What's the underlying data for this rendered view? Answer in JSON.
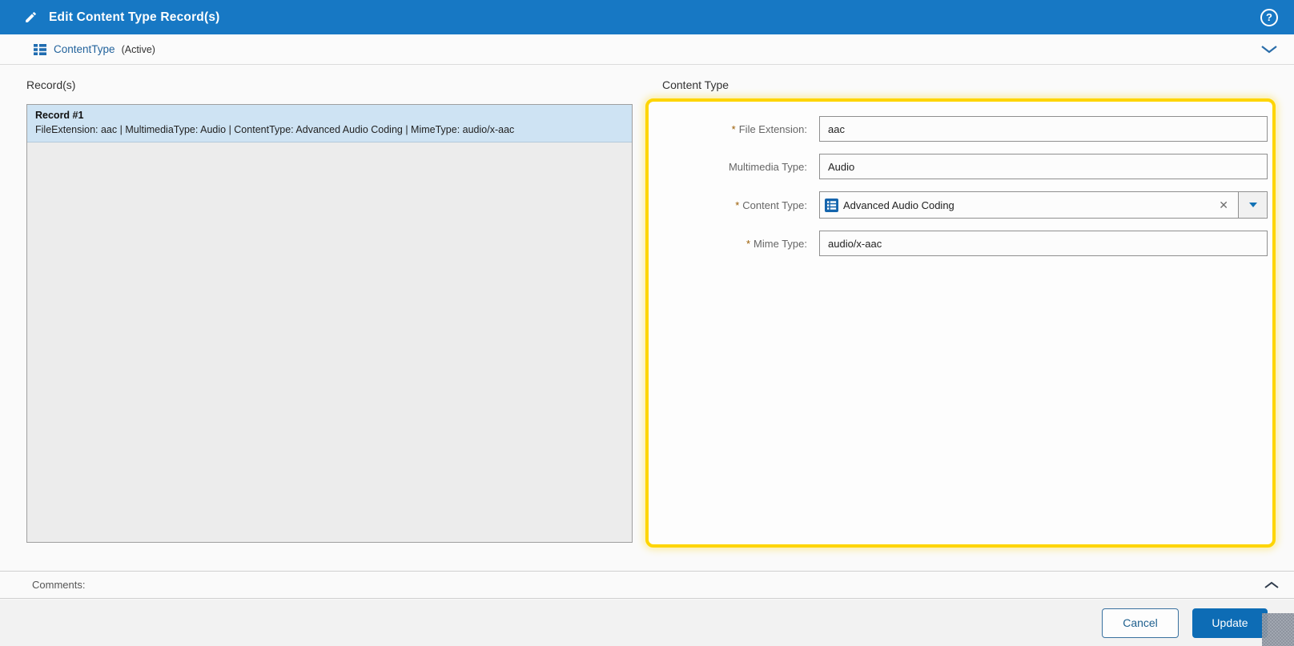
{
  "header": {
    "title": "Edit Content Type Record(s)"
  },
  "subheader": {
    "entity_name": "ContentType",
    "status": "(Active)"
  },
  "records_panel": {
    "title": "Record(s)",
    "items": [
      {
        "title": "Record #1",
        "summary": "FileExtension: aac | MultimediaType: Audio | ContentType: Advanced Audio Coding | MimeType: audio/x-aac",
        "selected": true
      }
    ]
  },
  "form_panel": {
    "title": "Content Type",
    "fields": [
      {
        "label": "File Extension:",
        "required_marker": "*",
        "type": "text",
        "value": "aac"
      },
      {
        "label": "Multimedia Type:",
        "required_marker": "",
        "type": "text",
        "value": "Audio"
      },
      {
        "label": "Content Type:",
        "required_marker": "*",
        "type": "lookup",
        "value": "Advanced Audio Coding"
      },
      {
        "label": "Mime Type:",
        "required_marker": "*",
        "type": "text",
        "value": "audio/x-aac"
      }
    ]
  },
  "comments": {
    "label": "Comments:"
  },
  "footer": {
    "cancel_label": "Cancel",
    "update_label": "Update"
  },
  "glyphs": {
    "help": "?",
    "clear": "✕"
  },
  "colors": {
    "header_bg": "#1778c4",
    "accent_blue": "#0d6cb5",
    "link_blue": "#23639c",
    "highlight_yellow": "#fed500",
    "selected_row": "#cee3f3",
    "required_marker": "#9a5b00"
  }
}
